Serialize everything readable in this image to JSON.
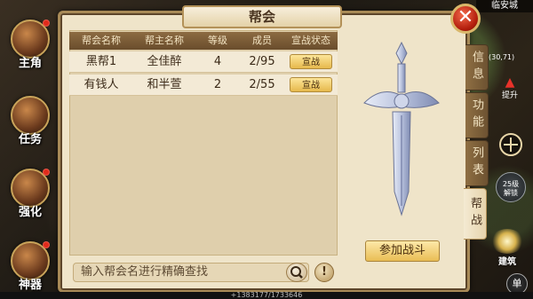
{
  "panel": {
    "title": "帮会",
    "close_symbol": "✕"
  },
  "left_menu": [
    {
      "label": "主角",
      "icon": "hero-portrait-icon",
      "has_alert": true
    },
    {
      "label": "任务",
      "icon": "task-scroll-icon",
      "has_alert": false
    },
    {
      "label": "强化",
      "icon": "strengthen-anvil-icon",
      "has_alert": true
    },
    {
      "label": "神器",
      "icon": "artifact-icon",
      "has_alert": true
    }
  ],
  "table": {
    "headers": [
      "帮会名称",
      "帮主名称",
      "等级",
      "成员",
      "宣战状态"
    ],
    "rows": [
      {
        "guild": "黑帮1",
        "leader": "全佳醉",
        "level": "4",
        "members": "2/95",
        "action": "宣战"
      },
      {
        "guild": "有钱人",
        "leader": "和半萱",
        "level": "2",
        "members": "2/55",
        "action": "宣战"
      }
    ]
  },
  "search": {
    "placeholder": "输入帮会名进行精确查找",
    "info_symbol": "!"
  },
  "join_battle_label": "参加战斗",
  "tabs": [
    {
      "label": "信息",
      "active": false
    },
    {
      "label": "功能",
      "active": false
    },
    {
      "label": "列表",
      "active": false
    },
    {
      "label": "帮战",
      "active": true
    }
  ],
  "hud": {
    "city": "临安城",
    "coord": "(30,71)",
    "upgrade_label": "提升",
    "unlock_label": "25级\n解锁",
    "skill_label": "建筑",
    "single_label": "单",
    "bottom_text": "+1383177/1733646"
  },
  "colors": {
    "panel_bg": "#efe4c9",
    "header_bg": "#7a5a35",
    "button_gold": "#e9bd55",
    "close_red": "#c92a14"
  }
}
